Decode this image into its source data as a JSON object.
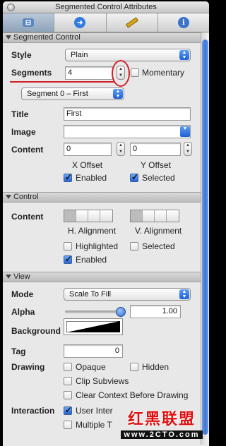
{
  "window": {
    "title": "Segmented Control Attributes"
  },
  "tabs": [
    {
      "icon": "attributes-icon",
      "color": "#4a7fd0"
    },
    {
      "icon": "connections-icon",
      "color": "#2f7be0"
    },
    {
      "icon": "size-icon",
      "color": "#d7a51a"
    },
    {
      "icon": "identity-icon",
      "color": "#3a73c8"
    }
  ],
  "segmented_control": {
    "header": "Segmented Control",
    "style_label": "Style",
    "style_value": "Plain",
    "segments_label": "Segments",
    "segments_value": "4",
    "momentary_label": "Momentary",
    "segment_selector": "Segment 0 – First",
    "title_label": "Title",
    "title_value": "First",
    "image_label": "Image",
    "image_value": "",
    "content_label": "Content",
    "x_offset_value": "0",
    "y_offset_value": "0",
    "x_offset_label": "X Offset",
    "y_offset_label": "Y Offset",
    "enabled_label": "Enabled",
    "selected_label": "Selected"
  },
  "control": {
    "header": "Control",
    "content_label": "Content",
    "h_alignment_label": "H. Alignment",
    "v_alignment_label": "V. Alignment",
    "highlighted_label": "Highlighted",
    "selected_label": "Selected",
    "enabled_label": "Enabled"
  },
  "view": {
    "header": "View",
    "mode_label": "Mode",
    "mode_value": "Scale To Fill",
    "alpha_label": "Alpha",
    "alpha_value": "1.00",
    "alpha_level": 1.0,
    "background_label": "Background",
    "tag_label": "Tag",
    "tag_value": "0",
    "drawing_label": "Drawing",
    "opaque_label": "Opaque",
    "hidden_label": "Hidden",
    "clip_subviews_label": "Clip Subviews",
    "clear_context_label": "Clear Context Before Drawing",
    "interaction_label": "Interaction",
    "user_interaction_label": "User Inter",
    "multiple_touch_label": "Multiple T"
  },
  "watermark": {
    "chinese": "红黑联盟",
    "url": "www.2CTO.com"
  },
  "colors": {
    "annotation": "#d2202a",
    "accent": "#2563d6"
  }
}
